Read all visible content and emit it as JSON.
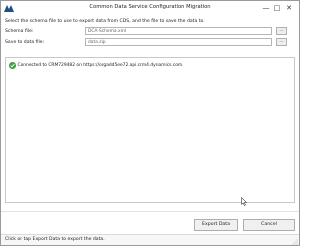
{
  "window": {
    "title": "Common Data Service Configuration Migration",
    "minimize_glyph": "—",
    "maximize_glyph": "□",
    "close_glyph": "✕"
  },
  "form": {
    "instruction": "Select the schema file to use to export data from CDS, and the file to save the data to.",
    "schema_label": "Schema file:",
    "schema_value": "DCA-Schema.xml",
    "save_label": "Save to data file:",
    "save_value": "data.zip",
    "browse_label": "..."
  },
  "log": {
    "message": "Connected to CRM729482 on https://orgadd5ee72.api.crm4.dynamics.com.",
    "status_icon": "success-check-icon"
  },
  "buttons": {
    "export_label": "Export Data",
    "cancel_label": "Cancel"
  },
  "status_bar": {
    "text": "Click or tap Export Data to export the data."
  },
  "colors": {
    "success": "#3fa347",
    "app_icon": "#1f4f8a"
  }
}
